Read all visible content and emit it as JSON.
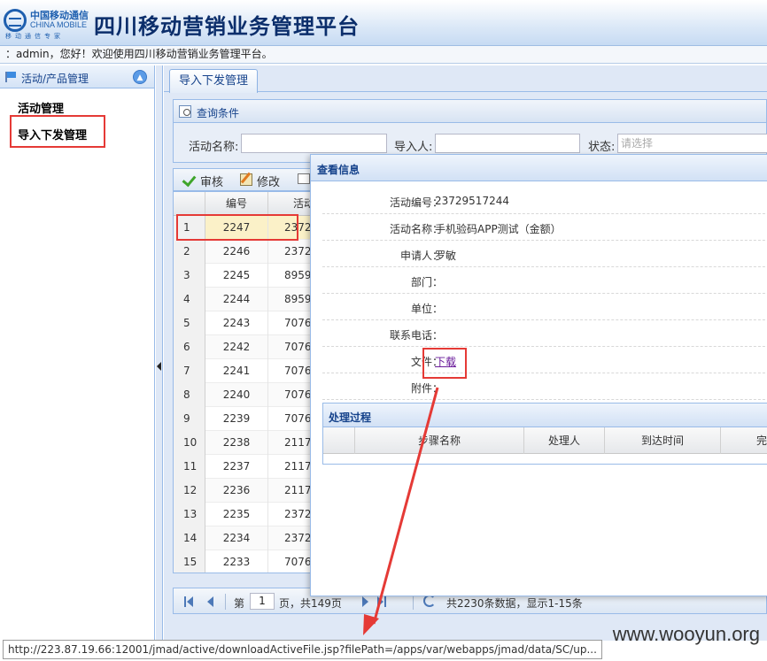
{
  "header": {
    "logo_cn": "中国移动通信",
    "logo_en": "CHINA MOBILE",
    "logo_sub": "移动通信专家",
    "app_title": "四川移动营销业务管理平台"
  },
  "welcome_text": "：admin，您好！欢迎使用四川移动营销业务管理平台。",
  "sidebar": {
    "title": "活动/产品管理",
    "collapse_icon": "chevron-up-icon",
    "items": [
      {
        "label": "活动管理"
      },
      {
        "label": "导入下发管理"
      }
    ]
  },
  "tabs": [
    {
      "label": "导入下发管理"
    }
  ],
  "query": {
    "title": "查询条件",
    "activity_name_label": "活动名称:",
    "importer_label": "导入人:",
    "status_label": "状态:",
    "status_placeholder": "请选择"
  },
  "toolbar": {
    "approve_label": "审核",
    "edit_label": "修改"
  },
  "grid": {
    "columns": [
      "编号",
      "活动"
    ],
    "rows": [
      {
        "n": "1",
        "id": "2247",
        "act": "2372"
      },
      {
        "n": "2",
        "id": "2246",
        "act": "2372"
      },
      {
        "n": "3",
        "id": "2245",
        "act": "8959"
      },
      {
        "n": "4",
        "id": "2244",
        "act": "8959"
      },
      {
        "n": "5",
        "id": "2243",
        "act": "7076"
      },
      {
        "n": "6",
        "id": "2242",
        "act": "7076"
      },
      {
        "n": "7",
        "id": "2241",
        "act": "7076"
      },
      {
        "n": "8",
        "id": "2240",
        "act": "7076"
      },
      {
        "n": "9",
        "id": "2239",
        "act": "7076"
      },
      {
        "n": "10",
        "id": "2238",
        "act": "2117"
      },
      {
        "n": "11",
        "id": "2237",
        "act": "2117"
      },
      {
        "n": "12",
        "id": "2236",
        "act": "2117"
      },
      {
        "n": "13",
        "id": "2235",
        "act": "2372"
      },
      {
        "n": "14",
        "id": "2234",
        "act": "2372"
      },
      {
        "n": "15",
        "id": "2233",
        "act": "7076"
      }
    ]
  },
  "pager": {
    "page_prefix": "第",
    "current_page": "1",
    "page_suffix": "页，共149页",
    "summary": "共2230条数据，显示1-15条"
  },
  "popup": {
    "title": "查看信息",
    "fields": [
      {
        "label": "活动编号：",
        "value": "23729517244"
      },
      {
        "label": "活动名称：",
        "value": "手机验码APP测试（金额）"
      },
      {
        "label": "申请人：",
        "value": "罗敏"
      },
      {
        "label": "部门：",
        "value": ""
      },
      {
        "label": "单位：",
        "value": ""
      },
      {
        "label": "联系电话：",
        "value": ""
      },
      {
        "label": "文件：",
        "value": "下载"
      },
      {
        "label": "附件：",
        "value": ""
      }
    ],
    "process": {
      "title": "处理过程",
      "columns": [
        "步骤名称",
        "处理人",
        "到达时间",
        "完"
      ]
    }
  },
  "statusbar_url": "http://223.87.19.66:12001/jmad/active/downloadActiveFile.jsp?filePath=/apps/var/webapps/jmad/data/SC/up...",
  "watermark": "www.wooyun.org",
  "colors": {
    "accent": "#15428b",
    "highlight": "#e53a36",
    "selected_row": "#fbf1c8"
  }
}
